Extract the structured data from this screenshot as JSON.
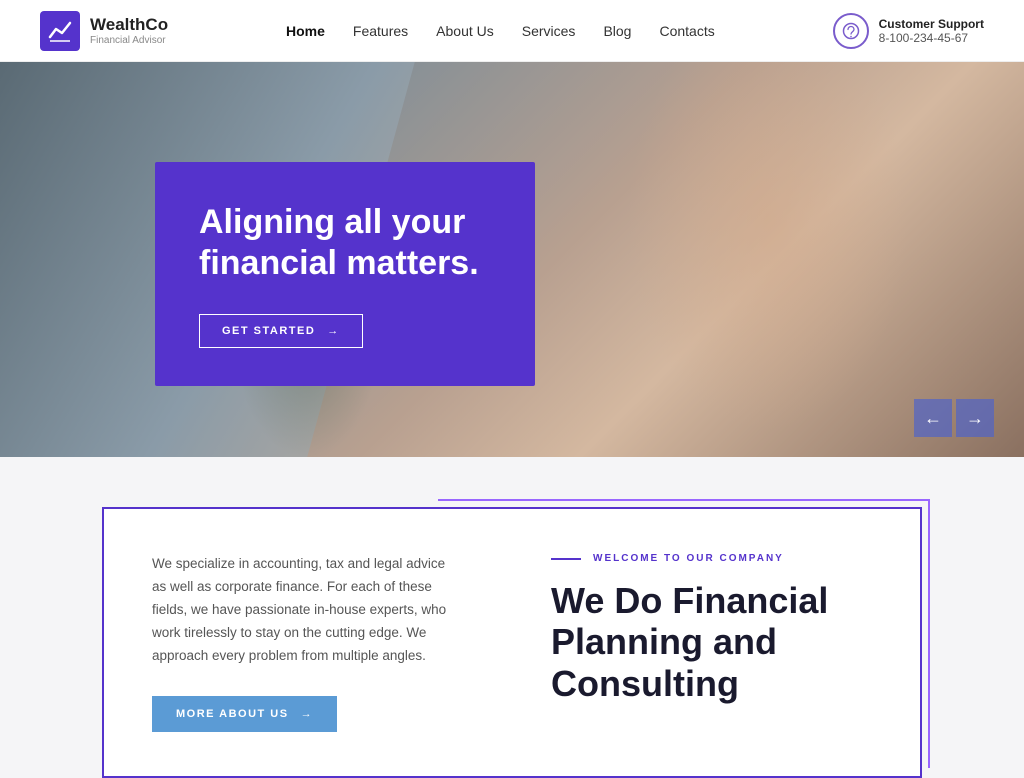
{
  "logo": {
    "name": "WealthCo",
    "subtitle": "Financial Advisor"
  },
  "nav": {
    "items": [
      {
        "label": "Home",
        "active": true
      },
      {
        "label": "Features",
        "active": false
      },
      {
        "label": "About Us",
        "active": false
      },
      {
        "label": "Services",
        "active": false
      },
      {
        "label": "Blog",
        "active": false
      },
      {
        "label": "Contacts",
        "active": false
      }
    ]
  },
  "support": {
    "label": "Customer Support",
    "phone": "8-100-234-45-67"
  },
  "hero": {
    "heading": "Aligning all your financial matters.",
    "cta_label": "GET STARTED",
    "nav_prev": "←",
    "nav_next": "→"
  },
  "section": {
    "welcome_label": "WELCOME TO OUR COMPANY",
    "body_text": "We specialize in accounting, tax and legal advice as well as corporate finance. For each of these fields, we have passionate in-house experts, who work tirelessly to stay on the cutting edge. We approach every problem from multiple angles.",
    "more_btn": "MORE ABOUT US",
    "heading_line1": "We Do Financial",
    "heading_line2": "Planning and",
    "heading_line3": "Consulting"
  }
}
